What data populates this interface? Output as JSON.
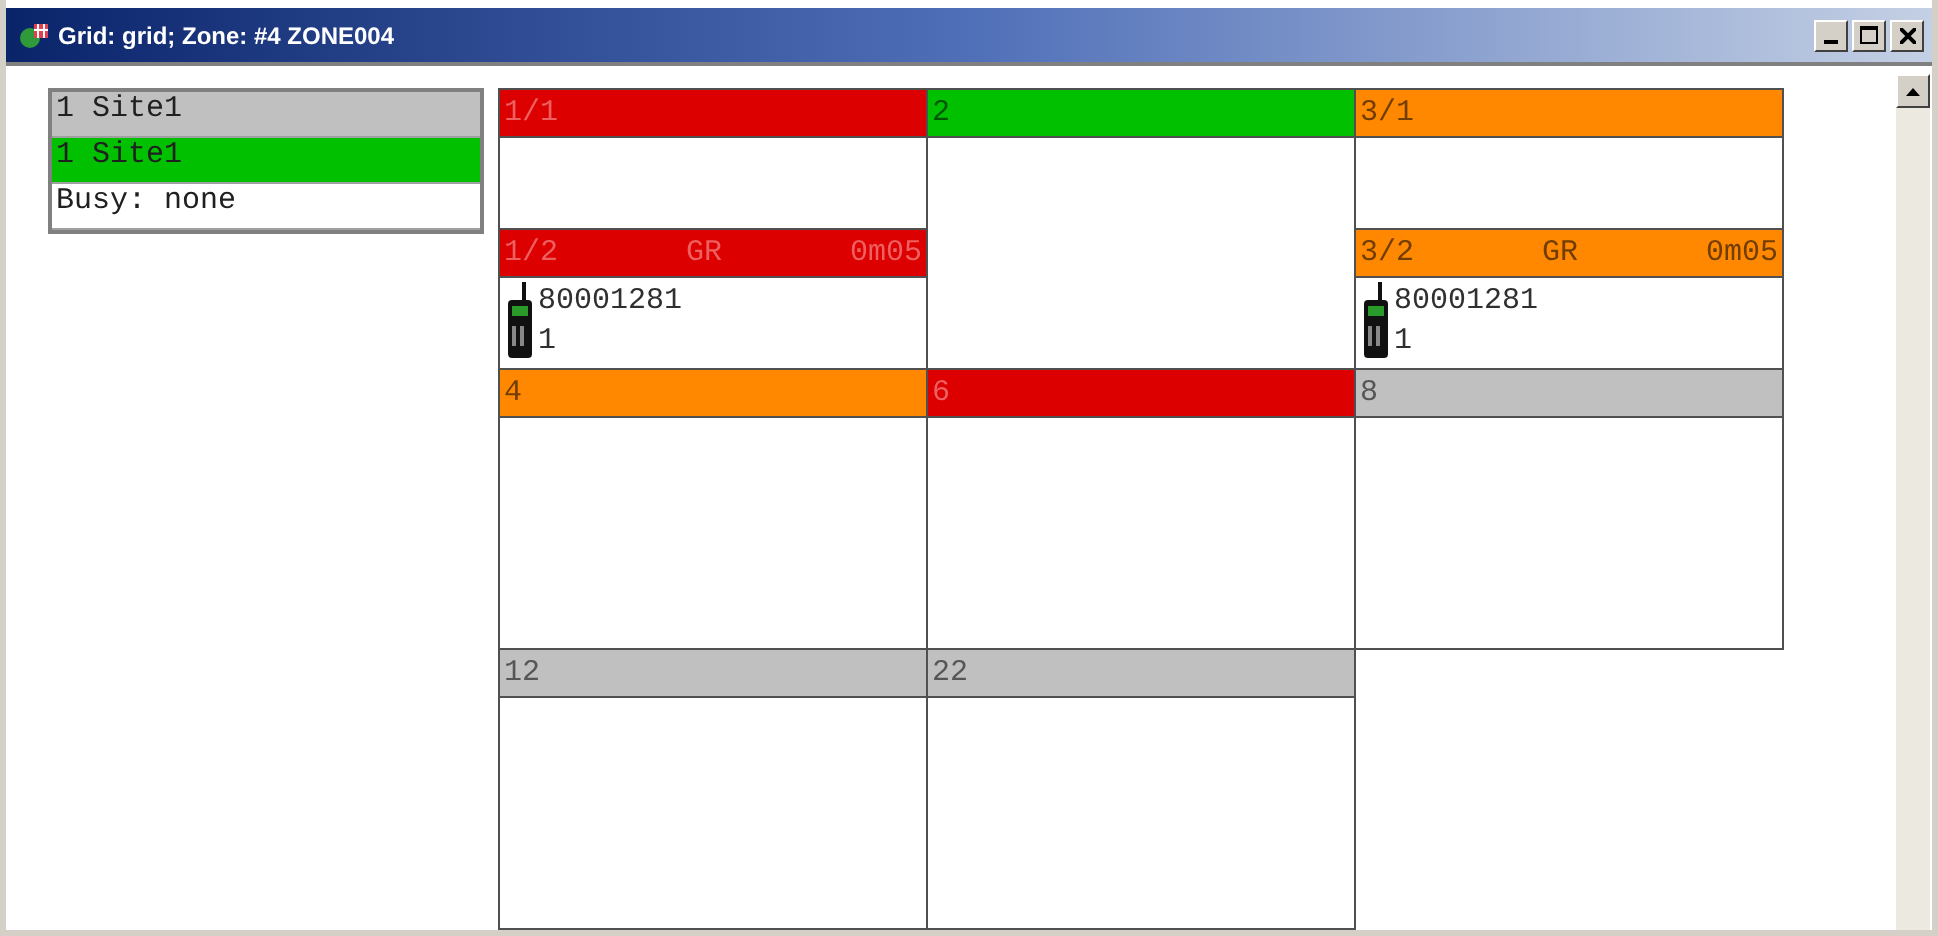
{
  "window": {
    "title": "Grid: grid; Zone: #4  ZONE004"
  },
  "site_list": [
    {
      "label": "1 Site1",
      "color": "#c0c0c0"
    },
    {
      "label": "1 Site1",
      "color": "#00c000"
    },
    {
      "label": "Busy: none",
      "color": "#ffffff"
    }
  ],
  "columns": [
    {
      "cells": [
        {
          "kind": "half",
          "label": "1/1",
          "color": "#dd0000"
        },
        {
          "kind": "half",
          "label": "1/2",
          "color": "#dd0000",
          "group": "GR",
          "duration": "0m05",
          "unit": {
            "id": "80001281",
            "line": "1"
          }
        },
        {
          "kind": "full",
          "label": "4",
          "color": "#ff8800"
        },
        {
          "kind": "full",
          "label": "12",
          "color": "#c0c0c0"
        }
      ]
    },
    {
      "cells": [
        {
          "kind": "full",
          "label": "2",
          "color": "#00c000"
        },
        {
          "kind": "full",
          "label": "6",
          "color": "#dd0000"
        },
        {
          "kind": "full",
          "label": "22",
          "color": "#c0c0c0"
        }
      ]
    },
    {
      "cells": [
        {
          "kind": "half",
          "label": "3/1",
          "color": "#ff8800"
        },
        {
          "kind": "half",
          "label": "3/2",
          "color": "#ff8800",
          "group": "GR",
          "duration": "0m05",
          "unit": {
            "id": "80001281",
            "line": "1"
          }
        },
        {
          "kind": "full",
          "label": "8",
          "color": "#c0c0c0"
        }
      ]
    }
  ]
}
